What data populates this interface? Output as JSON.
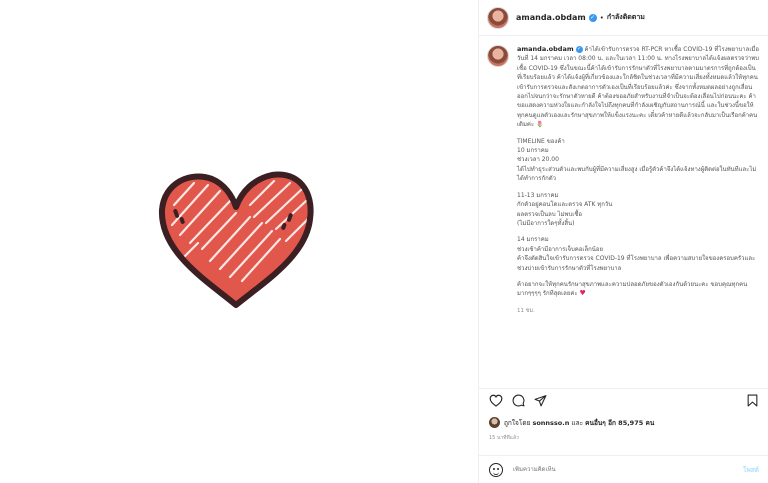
{
  "header": {
    "username": "amanda.obdam",
    "verified_mark": "✓",
    "separator": "•",
    "follow_status": "กำลังติดตาม"
  },
  "caption": {
    "username": "amanda.obdam",
    "verified_mark": "✓",
    "intro": "ค้าได้เข้ารับการตรวจ RT-PCR หาเชื้อ COVID-19 ที่โรงพยาบาลเมื่อวันที่ 14 มกราคม เวลา 08:00 น. และในเวลา 11:00 น. ทางโรงพยาบาลได้แจ้งผลตรวจว่าพบเชื้อ COVID-19 ซึ่งในขณะนี้ค้าได้เข้ารับการรักษาตัวที่โรงพยาบาลตามมาตรการที่ถูกต้องเป็นที่เรียบร้อยแล้ว ค้าได้แจ้งผู้ที่เกี่ยวข้องและใกล้ชิดในช่วงเวลาที่มีความเสี่ยงทั้งหมดแล้วให้ทุกคนเข้ารับการตรวจและสังเกตอาการตัวเองเป็นที่เรียบร้อยแล้วค่ะ ซึ่งจากทั้งหมดผลอย่างถูกเลื่อนออกไปจนกว่าจะรักษาตัวหายดี ค้าต้องขออภัยสำหรับงานที่จำเป็นจะต้องเลื่อนไปก่อนนะคะ ค้าขอแสดงความห่วงใยและกำลังใจไปถึงทุกคนที่กำลังเผชิญกับสถานการณ์นี้ และในช่วงนี้ขอให้ทุกคนดูแลตัวเองและรักษาสุขภาพให้แข็งแรงนะคะ เดี๋ยวค้าหายดีแล้วจะกลับมาเป็นเรือกค้าคนเดิมค่ะ",
    "intro_emoji": "🌷",
    "timeline_title": "TIMELINE ของค้า",
    "day1_date": "10 มกราคม",
    "day1_time": "ช่วงเวลา 20.00",
    "day1_text": "ได้ไปทำธุระส่วนตัวและพบกับผู้ที่มีความเสี่ยงสูง เมื่อรู้ตัวค้าจึงได้แจ้งทางผู้ติดต่อในทันทีและไม่ได้ทำการกักตัว",
    "day2_date": "11-13 มกราคม",
    "day2_line1": "กักตัวอยู่คอนโดและตรวจ ATK ทุกวัน",
    "day2_line2": "ผลตรวจเป็นลบ ไม่พบเชื้อ",
    "day2_line3": "(ไม่มีอาการใดๆทั้งสิ้น)",
    "day3_date": "14 มกราคม",
    "day3_line1": "ช่วงเช้าค้ามีอาการเจ็บคอเล็กน้อย",
    "day3_line2": "ค้าจึงตัดสินใจเข้ารับการตรวจ COVID-19 ที่โรงพยาบาล เพื่อความสบายใจของครอบครัวและช่วงบ่ายเข้ารับการรักษาตัวที่โรงพยาบาล",
    "closing": "ค้าอยากจะให้ทุกคนรักษาสุขภาพและความปลอดภัยของตัวเองกันด้วยนะคะ ขอบคุณทุกคนมากๆๆๆๆ รักทีสุดเลยค่ะ",
    "closing_emoji": "♥",
    "time_ago": "11 ชม."
  },
  "actions": {
    "like_icon": "heart-outline-icon",
    "comment_icon": "comment-bubble-icon",
    "share_icon": "paper-plane-icon",
    "save_icon": "bookmark-icon"
  },
  "likes": {
    "prefix": "ถูกใจโดย",
    "liker": "sonnsso.n",
    "middle": "และ",
    "others_label": "คนอื่นๆ อีก 85,975 คน"
  },
  "date": "15 นาทีที่แล้ว",
  "comment": {
    "placeholder": "เพิ่มความคิดเห็น",
    "post_label": "โพสต์"
  },
  "colors": {
    "heart_fill": "#e2574c",
    "heart_outline": "#3b1f22",
    "verified": "#3897f0",
    "post_button": "#b2dffc"
  }
}
